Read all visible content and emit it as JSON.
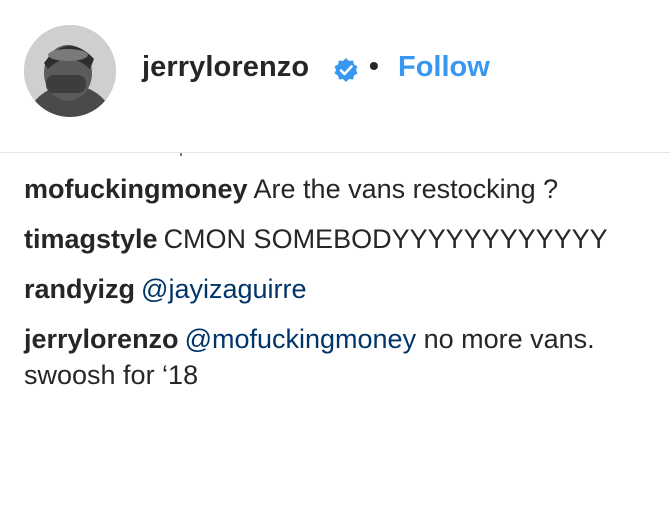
{
  "header": {
    "username": "jerrylorenzo",
    "separator": "•",
    "follow_label": "Follow",
    "verified_icon": "verified-badge-icon",
    "accent_color": "#3897f0"
  },
  "comments": [
    {
      "user": "mofuckingmoney",
      "text": "Are the vans restocking ?"
    },
    {
      "user": "timagstyle",
      "text": "CMON SOMEBODYYYYYYYYYYYY"
    },
    {
      "user": "randyizg",
      "mention": "@jayizaguirre",
      "text": ""
    },
    {
      "user": "jerrylorenzo",
      "mention": "@mofuckingmoney",
      "text": "no more vans. swoosh for ‘18"
    }
  ]
}
